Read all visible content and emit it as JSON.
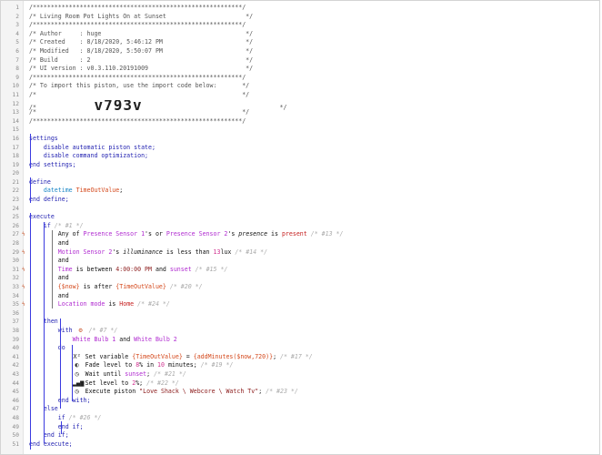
{
  "lines": [
    {
      "n": "1",
      "segs": [
        {
          "t": "/**********************************************************/",
          "c": "cmt"
        }
      ]
    },
    {
      "n": "2",
      "segs": [
        {
          "t": "/* Living Room Pot Lights On at Sunset                      */",
          "c": "cmt"
        }
      ]
    },
    {
      "n": "3",
      "segs": [
        {
          "t": "/**********************************************************/",
          "c": "cmt"
        }
      ]
    },
    {
      "n": "4",
      "segs": [
        {
          "t": "/* Author     : huge                                        */",
          "c": "cmt"
        }
      ]
    },
    {
      "n": "5",
      "segs": [
        {
          "t": "/* Created    : 8/18/2020, 5:46:12 PM                       */",
          "c": "cmt"
        }
      ]
    },
    {
      "n": "6",
      "segs": [
        {
          "t": "/* Modified   : 8/18/2020, 5:50:07 PM                       */",
          "c": "cmt"
        }
      ]
    },
    {
      "n": "7",
      "segs": [
        {
          "t": "/* Build      : 2                                           */",
          "c": "cmt"
        }
      ]
    },
    {
      "n": "8",
      "segs": [
        {
          "t": "/* UI version : v0.3.110.20191009                           */",
          "c": "cmt"
        }
      ]
    },
    {
      "n": "9",
      "segs": [
        {
          "t": "/**********************************************************/",
          "c": "cmt"
        }
      ]
    },
    {
      "n": "10",
      "segs": [
        {
          "t": "/* To import this piston, use the import code below:       */",
          "c": "cmt"
        }
      ]
    },
    {
      "n": "11",
      "segs": [
        {
          "t": "/*                                                         */",
          "c": "cmt"
        }
      ]
    },
    {
      "n": "12",
      "segs": [
        {
          "t": "/*                ",
          "c": "cmt"
        },
        {
          "t": "v793v",
          "c": "big"
        },
        {
          "t": "                                      */",
          "c": "cmt"
        }
      ]
    },
    {
      "n": "13",
      "segs": [
        {
          "t": "/*                                                         */",
          "c": "cmt"
        }
      ]
    },
    {
      "n": "14",
      "segs": [
        {
          "t": "/**********************************************************/",
          "c": "cmt"
        }
      ]
    },
    {
      "n": "15",
      "segs": []
    },
    {
      "n": "16",
      "segs": [
        {
          "t": "settings",
          "c": "kw"
        }
      ]
    },
    {
      "n": "17",
      "segs": [
        {
          "t": "    disable automatic piston state;",
          "c": "kw"
        }
      ]
    },
    {
      "n": "18",
      "segs": [
        {
          "t": "    disable command optimization;",
          "c": "kw"
        }
      ]
    },
    {
      "n": "19",
      "segs": [
        {
          "t": "end settings;",
          "c": "kw"
        }
      ]
    },
    {
      "n": "20",
      "segs": []
    },
    {
      "n": "21",
      "segs": [
        {
          "t": "define",
          "c": "kw"
        }
      ]
    },
    {
      "n": "22",
      "segs": [
        {
          "t": "    datetime ",
          "c": "typ"
        },
        {
          "t": "TimeOutValue",
          "c": "var"
        },
        {
          "t": ";",
          "c": ""
        }
      ]
    },
    {
      "n": "23",
      "segs": [
        {
          "t": "end define;",
          "c": "kw"
        }
      ]
    },
    {
      "n": "24",
      "segs": []
    },
    {
      "n": "25",
      "segs": [
        {
          "t": "execute",
          "c": "kw"
        }
      ]
    },
    {
      "n": "26",
      "segs": [
        {
          "t": "    if ",
          "c": "kw"
        },
        {
          "t": "/* #1 */",
          "c": "cmtl"
        }
      ]
    },
    {
      "n": "27",
      "mark": true,
      "segs": [
        {
          "t": "        Any of ",
          "c": ""
        },
        {
          "t": "Presence Sensor 1",
          "c": "dev"
        },
        {
          "t": "'s or ",
          "c": ""
        },
        {
          "t": "Presence Sensor 2",
          "c": "dev"
        },
        {
          "t": "'s ",
          "c": ""
        },
        {
          "t": "presence",
          "c": "attr"
        },
        {
          "t": " is ",
          "c": ""
        },
        {
          "t": "present",
          "c": "val"
        },
        {
          "t": " /* #13 */",
          "c": "cmtl"
        }
      ]
    },
    {
      "n": "28",
      "segs": [
        {
          "t": "        and",
          "c": ""
        }
      ]
    },
    {
      "n": "29",
      "mark": true,
      "segs": [
        {
          "t": "        ",
          "c": ""
        },
        {
          "t": "Motion Sensor 2",
          "c": "dev"
        },
        {
          "t": "'s ",
          "c": ""
        },
        {
          "t": "illuminance",
          "c": "attr"
        },
        {
          "t": " is less than ",
          "c": ""
        },
        {
          "t": "13",
          "c": "num"
        },
        {
          "t": "lux",
          "c": ""
        },
        {
          "t": " /* #14 */",
          "c": "cmtl"
        }
      ]
    },
    {
      "n": "30",
      "segs": [
        {
          "t": "        and",
          "c": ""
        }
      ]
    },
    {
      "n": "31",
      "mark": true,
      "segs": [
        {
          "t": "        ",
          "c": ""
        },
        {
          "t": "Time",
          "c": "dev"
        },
        {
          "t": " is between ",
          "c": ""
        },
        {
          "t": "4:00:00 PM",
          "c": "str"
        },
        {
          "t": " and ",
          "c": ""
        },
        {
          "t": "sunset",
          "c": "dev"
        },
        {
          "t": " /* #15 */",
          "c": "cmtl"
        }
      ]
    },
    {
      "n": "32",
      "segs": [
        {
          "t": "        and",
          "c": ""
        }
      ]
    },
    {
      "n": "33",
      "mark": true,
      "segs": [
        {
          "t": "        ",
          "c": ""
        },
        {
          "t": "{$now}",
          "c": "var"
        },
        {
          "t": " is after ",
          "c": ""
        },
        {
          "t": "{TimeOutValue}",
          "c": "var"
        },
        {
          "t": " /* #20 */",
          "c": "cmtl"
        }
      ]
    },
    {
      "n": "34",
      "segs": [
        {
          "t": "        and",
          "c": ""
        }
      ]
    },
    {
      "n": "35",
      "mark": true,
      "segs": [
        {
          "t": "        ",
          "c": ""
        },
        {
          "t": "Location mode",
          "c": "dev"
        },
        {
          "t": " is ",
          "c": ""
        },
        {
          "t": "Home",
          "c": "val"
        },
        {
          "t": " /* #24 */",
          "c": "cmtl"
        }
      ]
    },
    {
      "n": "36",
      "segs": []
    },
    {
      "n": "37",
      "segs": [
        {
          "t": "    then",
          "c": "kw"
        }
      ]
    },
    {
      "n": "38",
      "segs": [
        {
          "t": "        with ",
          "c": "kw"
        },
        {
          "ico": "gear",
          "c": "ico ico-red"
        },
        {
          "t": " /* #7 */",
          "c": "cmtl"
        }
      ]
    },
    {
      "n": "39",
      "segs": [
        {
          "t": "            ",
          "c": ""
        },
        {
          "t": "White Bulb 1",
          "c": "dev"
        },
        {
          "t": " and ",
          "c": ""
        },
        {
          "t": "White Bulb 2",
          "c": "dev"
        }
      ]
    },
    {
      "n": "40",
      "segs": [
        {
          "t": "        do",
          "c": "kw"
        }
      ]
    },
    {
      "n": "41",
      "segs": [
        {
          "t": "            ",
          "c": ""
        },
        {
          "ico": "x2",
          "c": "ico"
        },
        {
          "t": " Set variable ",
          "c": ""
        },
        {
          "t": "{TimeOutValue}",
          "c": "var"
        },
        {
          "t": " = ",
          "c": ""
        },
        {
          "t": "{addMinutes($now,720)}",
          "c": "var"
        },
        {
          "t": "; ",
          "c": ""
        },
        {
          "t": "/* #17 */",
          "c": "cmtl"
        }
      ]
    },
    {
      "n": "42",
      "segs": [
        {
          "t": "            ",
          "c": ""
        },
        {
          "ico": "fade",
          "c": "ico"
        },
        {
          "t": " Fade level to ",
          "c": ""
        },
        {
          "t": "8",
          "c": "num"
        },
        {
          "t": "% in ",
          "c": ""
        },
        {
          "t": "10",
          "c": "num"
        },
        {
          "t": " minutes; ",
          "c": ""
        },
        {
          "t": "/* #19 */",
          "c": "cmtl"
        }
      ]
    },
    {
      "n": "43",
      "segs": [
        {
          "t": "            ",
          "c": ""
        },
        {
          "ico": "clock",
          "c": "ico"
        },
        {
          "t": " Wait until ",
          "c": ""
        },
        {
          "t": "sunset",
          "c": "dev"
        },
        {
          "t": "; ",
          "c": ""
        },
        {
          "t": "/* #21 */",
          "c": "cmtl"
        }
      ]
    },
    {
      "n": "44",
      "segs": [
        {
          "t": "            ",
          "c": ""
        },
        {
          "ico": "bars",
          "c": "ico"
        },
        {
          "t": " Set level to ",
          "c": ""
        },
        {
          "t": "2",
          "c": "num"
        },
        {
          "t": "%; ",
          "c": ""
        },
        {
          "t": "/* #22 */",
          "c": "cmtl"
        }
      ]
    },
    {
      "n": "45",
      "segs": [
        {
          "t": "            ",
          "c": ""
        },
        {
          "ico": "clock",
          "c": "ico"
        },
        {
          "t": " Execute piston ",
          "c": ""
        },
        {
          "t": "\"Love Shack \\ Webcore \\ Watch Tv\"",
          "c": "str"
        },
        {
          "t": "; ",
          "c": ""
        },
        {
          "t": "/* #23 */",
          "c": "cmtl"
        }
      ]
    },
    {
      "n": "46",
      "segs": [
        {
          "t": "        end with;",
          "c": "kw"
        }
      ]
    },
    {
      "n": "47",
      "segs": [
        {
          "t": "    else",
          "c": "kw"
        }
      ]
    },
    {
      "n": "48",
      "segs": [
        {
          "t": "        if ",
          "c": "kw"
        },
        {
          "t": "/* #26 */",
          "c": "cmtl"
        }
      ]
    },
    {
      "n": "49",
      "segs": [
        {
          "t": "        end if;",
          "c": "kw"
        }
      ]
    },
    {
      "n": "50",
      "segs": [
        {
          "t": "    end if;",
          "c": "kw"
        }
      ]
    },
    {
      "n": "51",
      "segs": [
        {
          "t": "end execute;",
          "c": "kw"
        }
      ]
    }
  ],
  "icons": {
    "gear": "⚙",
    "x2": "X²",
    "fade": "◐",
    "clock": "◷",
    "bars": "▂▄▆"
  },
  "trigger_icon": "ϟ"
}
